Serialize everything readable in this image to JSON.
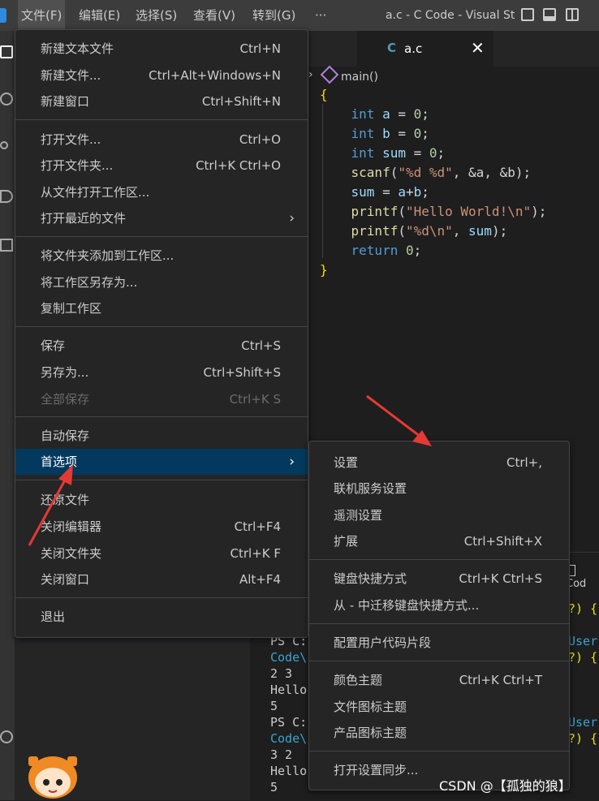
{
  "titlebar": {
    "menus": [
      "文件(F)",
      "编辑(E)",
      "选择(S)",
      "查看(V)",
      "转到(G)",
      "···"
    ],
    "window_title": "a.c - C Code - Visual St"
  },
  "editor": {
    "tab_icon": "C",
    "tab_name": "a.c",
    "breadcrumb_chevron": "›",
    "breadcrumb_symbol": "main()",
    "code": {
      "open_brace": "{",
      "line_a": [
        "int",
        "a",
        "=",
        "0",
        ";"
      ],
      "line_b": [
        "int",
        "b",
        "=",
        "0",
        ";"
      ],
      "line_sum": [
        "int",
        "sum",
        "=",
        "0",
        ";"
      ],
      "scanf_fn": "scanf",
      "scanf_str": "\"%d %d\"",
      "scanf_args": ", &a, &b);",
      "sum_line": [
        "sum",
        " = ",
        "a",
        "+",
        "b",
        ";"
      ],
      "printf1_fn": "printf",
      "printf1_str": "\"Hello World!\\n\"",
      "printf2_fn": "printf",
      "printf2_str": "\"%d\\n\"",
      "printf2_arg": "sum",
      "return_kw": "return",
      "return_val": "0",
      "close_brace": "}"
    }
  },
  "terminal": {
    "tab_label": "Cod",
    "lines": [
      "PS C:",
      "Code\\",
      "2 3",
      "Hello",
      "5",
      "PS C:",
      "Code\\",
      "3 2",
      "Hello",
      "5"
    ],
    "right_fragments": [
      "?) {",
      "User",
      "?) {",
      "User",
      "?) {"
    ]
  },
  "file_menu": {
    "items": [
      {
        "label": "新建文本文件",
        "shortcut": "Ctrl+N"
      },
      {
        "label": "新建文件...",
        "shortcut": "Ctrl+Alt+Windows+N"
      },
      {
        "label": "新建窗口",
        "shortcut": "Ctrl+Shift+N"
      },
      {
        "label": "打开文件...",
        "shortcut": "Ctrl+O"
      },
      {
        "label": "打开文件夹...",
        "shortcut": "Ctrl+K Ctrl+O"
      },
      {
        "label": "从文件打开工作区...",
        "shortcut": ""
      },
      {
        "label": "打开最近的文件",
        "shortcut": ""
      },
      {
        "label": "将文件夹添加到工作区...",
        "shortcut": ""
      },
      {
        "label": "将工作区另存为...",
        "shortcut": ""
      },
      {
        "label": "复制工作区",
        "shortcut": ""
      },
      {
        "label": "保存",
        "shortcut": "Ctrl+S"
      },
      {
        "label": "另存为...",
        "shortcut": "Ctrl+Shift+S"
      },
      {
        "label": "全部保存",
        "shortcut": "Ctrl+K S"
      },
      {
        "label": "自动保存",
        "shortcut": ""
      },
      {
        "label": "首选项",
        "shortcut": ""
      },
      {
        "label": "还原文件",
        "shortcut": ""
      },
      {
        "label": "关闭编辑器",
        "shortcut": "Ctrl+F4"
      },
      {
        "label": "关闭文件夹",
        "shortcut": "Ctrl+K F"
      },
      {
        "label": "关闭窗口",
        "shortcut": "Alt+F4"
      },
      {
        "label": "退出",
        "shortcut": ""
      }
    ],
    "submenu_arrow": "›"
  },
  "preferences_submenu": {
    "items": [
      {
        "label": "设置",
        "shortcut": "Ctrl+,"
      },
      {
        "label": "联机服务设置",
        "shortcut": ""
      },
      {
        "label": "遥测设置",
        "shortcut": ""
      },
      {
        "label": "扩展",
        "shortcut": "Ctrl+Shift+X"
      },
      {
        "label": "键盘快捷方式",
        "shortcut": "Ctrl+K Ctrl+S"
      },
      {
        "label": "从 - 中迁移键盘快捷方式...",
        "shortcut": ""
      },
      {
        "label": "配置用户代码片段",
        "shortcut": ""
      },
      {
        "label": "颜色主题",
        "shortcut": "Ctrl+K Ctrl+T"
      },
      {
        "label": "文件图标主题",
        "shortcut": ""
      },
      {
        "label": "产品图标主题",
        "shortcut": ""
      },
      {
        "label": "打开设置同步...",
        "shortcut": ""
      }
    ]
  },
  "watermark": "CSDN @【孤独的狼】",
  "colors": {
    "accent": "#04395e",
    "annotation_arrow": "#e53935",
    "menu_bg": "#252526"
  }
}
